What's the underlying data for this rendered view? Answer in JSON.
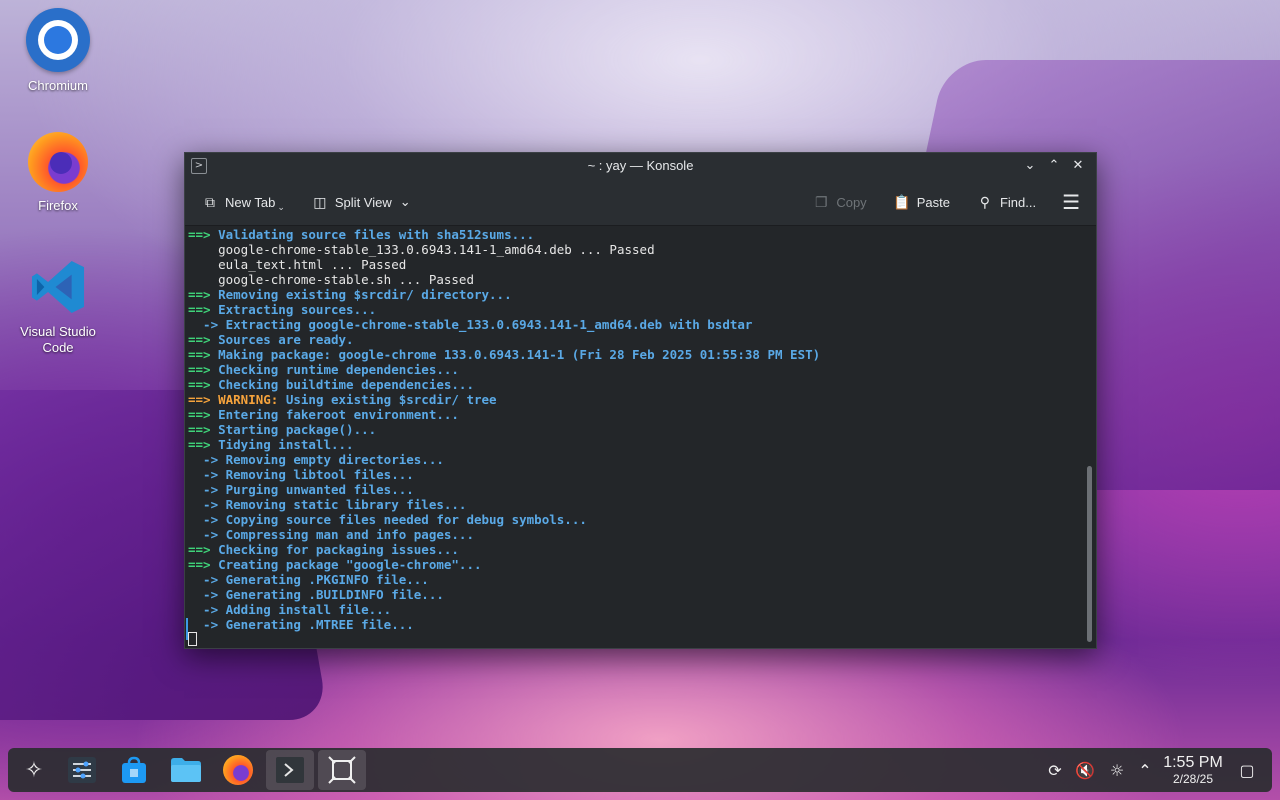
{
  "desktop": {
    "icons": [
      {
        "label": "Chromium"
      },
      {
        "label": "Firefox"
      },
      {
        "label": "Visual Studio Code"
      }
    ]
  },
  "window": {
    "title": "~ : yay — Konsole",
    "toolbar": {
      "new_tab": "New Tab",
      "split_view": "Split View",
      "copy": "Copy",
      "paste": "Paste",
      "find": "Find..."
    }
  },
  "terminal": {
    "lines": [
      {
        "kind": "stage",
        "prefix": "==>",
        "text": " Validating source files with sha512sums..."
      },
      {
        "kind": "plain",
        "prefix": "",
        "text": "    google-chrome-stable_133.0.6943.141-1_amd64.deb ... Passed"
      },
      {
        "kind": "plain",
        "prefix": "",
        "text": "    eula_text.html ... Passed"
      },
      {
        "kind": "plain",
        "prefix": "",
        "text": "    google-chrome-stable.sh ... Passed"
      },
      {
        "kind": "stage",
        "prefix": "==>",
        "text": " Removing existing $srcdir/ directory..."
      },
      {
        "kind": "stage",
        "prefix": "==>",
        "text": " Extracting sources..."
      },
      {
        "kind": "sub",
        "prefix": "  ->",
        "text": " Extracting google-chrome-stable_133.0.6943.141-1_amd64.deb with bsdtar"
      },
      {
        "kind": "stage",
        "prefix": "==>",
        "text": " Sources are ready."
      },
      {
        "kind": "stage",
        "prefix": "==>",
        "text": " Making package: google-chrome 133.0.6943.141-1 (Fri 28 Feb 2025 01:55:38 PM EST)"
      },
      {
        "kind": "stage",
        "prefix": "==>",
        "text": " Checking runtime dependencies..."
      },
      {
        "kind": "stage",
        "prefix": "==>",
        "text": " Checking buildtime dependencies..."
      },
      {
        "kind": "warn",
        "prefix": "==>",
        "label": " WARNING:",
        "text": " Using existing $srcdir/ tree"
      },
      {
        "kind": "stage",
        "prefix": "==>",
        "text": " Entering fakeroot environment..."
      },
      {
        "kind": "stage",
        "prefix": "==>",
        "text": " Starting package()..."
      },
      {
        "kind": "stage",
        "prefix": "==>",
        "text": " Tidying install..."
      },
      {
        "kind": "sub",
        "prefix": "  ->",
        "text": " Removing empty directories..."
      },
      {
        "kind": "sub",
        "prefix": "  ->",
        "text": " Removing libtool files..."
      },
      {
        "kind": "sub",
        "prefix": "  ->",
        "text": " Purging unwanted files..."
      },
      {
        "kind": "sub",
        "prefix": "  ->",
        "text": " Removing static library files..."
      },
      {
        "kind": "sub",
        "prefix": "  ->",
        "text": " Copying source files needed for debug symbols..."
      },
      {
        "kind": "sub",
        "prefix": "  ->",
        "text": " Compressing man and info pages..."
      },
      {
        "kind": "stage",
        "prefix": "==>",
        "text": " Checking for packaging issues..."
      },
      {
        "kind": "stage",
        "prefix": "==>",
        "text": " Creating package \"google-chrome\"..."
      },
      {
        "kind": "sub",
        "prefix": "  ->",
        "text": " Generating .PKGINFO file..."
      },
      {
        "kind": "sub",
        "prefix": "  ->",
        "text": " Generating .BUILDINFO file..."
      },
      {
        "kind": "sub",
        "prefix": "  ->",
        "text": " Adding install file..."
      },
      {
        "kind": "sub",
        "prefix": "  ->",
        "text": " Generating .MTREE file..."
      }
    ]
  },
  "taskbar": {
    "apps": [
      "application-launcher-icon",
      "system-settings-icon",
      "discover-store-icon",
      "file-manager-icon",
      "firefox-icon",
      "konsole-icon",
      "screenshot-tool-icon"
    ],
    "clock": {
      "time": "1:55 PM",
      "date": "2/28/25"
    }
  },
  "colors": {
    "stage_arrow": "#3fd47a",
    "stage_text": "#5aa9e6",
    "warning": "#f6a33c",
    "terminal_bg": "#232629"
  }
}
